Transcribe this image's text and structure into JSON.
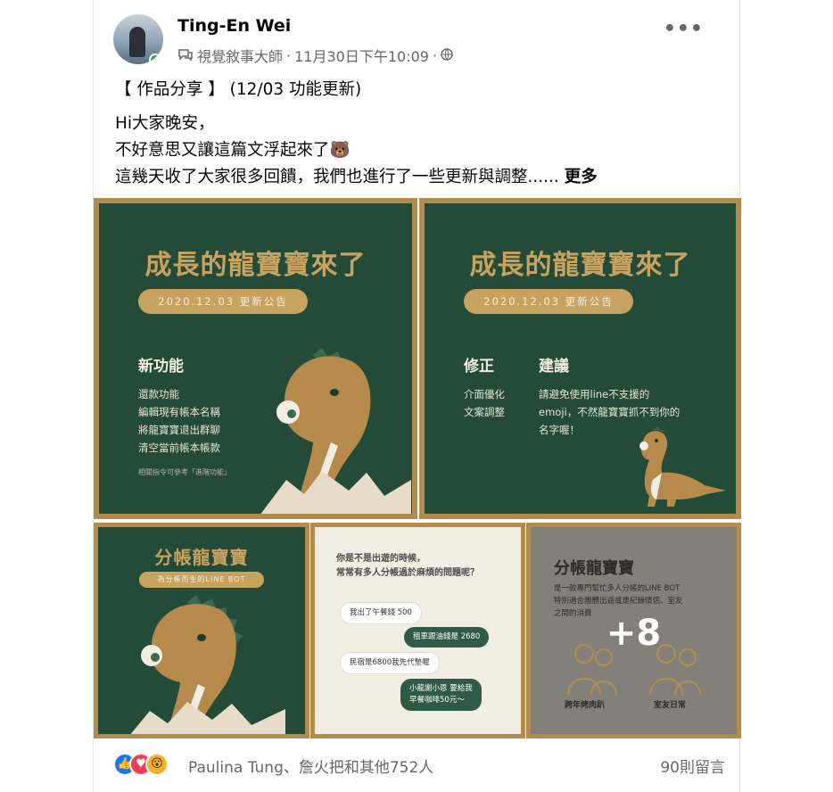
{
  "post": {
    "author": "Ting-En Wei",
    "group": "視覺敘事大師",
    "timestamp": "11月30日下午10:09",
    "separator": "·",
    "more_options": "•••",
    "title_line": "【 作品分享 】 (12/03 功能更新)",
    "body_lines": [
      "Hi大家晚安，",
      "不好意思又讓這篇文浮起來了🐻",
      "這幾天收了大家很多回饋，我們也進行了一些更新與調整......"
    ],
    "see_more": "更多"
  },
  "images": {
    "tile1": {
      "heading": "成長的龍寶寶來了",
      "pill": "2020.12.03 更新公告",
      "section": "新功能",
      "items": [
        "還款功能",
        "編輯現有帳本名稱",
        "將龍寶寶退出群聊",
        "清空當前帳本帳款"
      ],
      "note": "相關指令可參考「進階功能」"
    },
    "tile2": {
      "heading": "成長的龍寶寶來了",
      "pill": "2020.12.03 更新公告",
      "section_a": "修正",
      "section_b": "建議",
      "items_a": [
        "介面優化",
        "文案調整"
      ],
      "items_b": [
        "請避免使用line不支援的",
        "emoji，不然龍寶寶抓不到你的",
        "名字喔！"
      ]
    },
    "tile3": {
      "heading": "分帳龍寶寶",
      "pill": "為分帳而生的LINE BOT"
    },
    "tile4": {
      "question": [
        "你是不是出遊的時候，",
        "常常有多人分帳過於麻煩的問題呢？"
      ],
      "bubbles": [
        {
          "text": "我出了午餐錢 500",
          "style": "white"
        },
        {
          "text": "租車跟油錢是 2680",
          "style": "green"
        },
        {
          "text": "民宿是6800我先代墊喔",
          "style": "white"
        },
        {
          "text": "小龍謝小恩 要給我",
          "style": "green"
        },
        {
          "text": "早餐咖啡50元～",
          "style": "green"
        }
      ]
    },
    "tile5": {
      "heading": "分帳龍寶寶",
      "desc": [
        "是一款專門幫忙多人分帳的LINE BOT",
        "特別適合團體出遊或是紀錄情侶、室友",
        "之間的消費"
      ],
      "overlay": "+8",
      "labels": [
        "跨年烤肉趴",
        "室友日常"
      ]
    }
  },
  "reactions": {
    "icons": [
      "like-icon",
      "love-icon",
      "wow-icon"
    ],
    "names": "Paulina Tung、詹火把和其他752人",
    "comments": "90則留言"
  },
  "colors": {
    "green": "#244b37",
    "gold": "#b08d4e",
    "accent": "#c8a25f"
  }
}
